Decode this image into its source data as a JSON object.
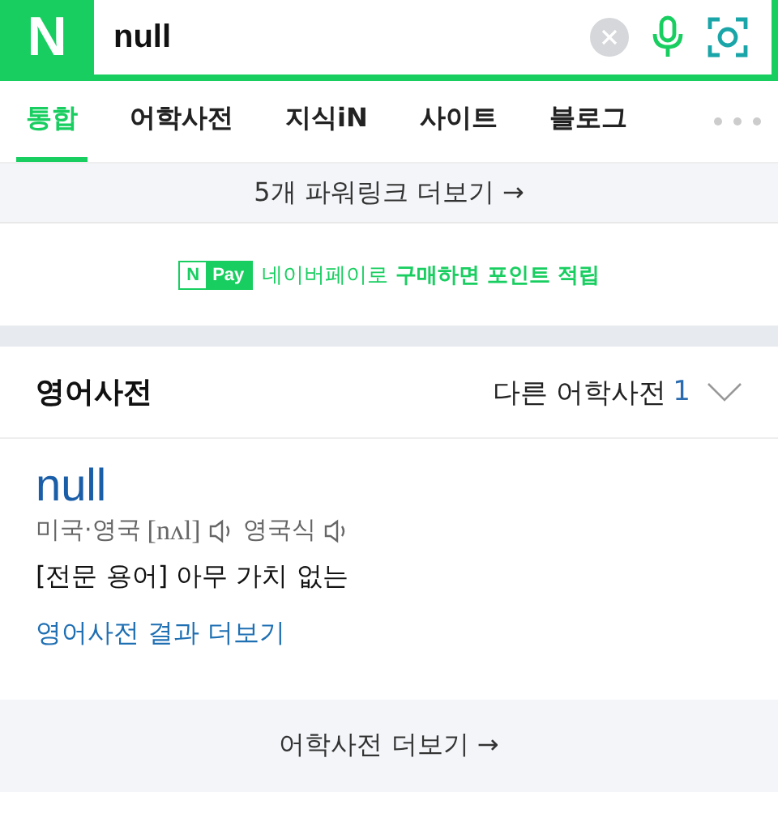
{
  "search": {
    "logo": "N",
    "query": "null"
  },
  "tabs": [
    {
      "label": "통합",
      "selected": true
    },
    {
      "label": "어학사전",
      "selected": false
    },
    {
      "label": "지식iN",
      "selected": false
    },
    {
      "label": "사이트",
      "selected": false
    },
    {
      "label": "블로그",
      "selected": false
    }
  ],
  "powerlink": {
    "label": "5개 파워링크 더보기 →"
  },
  "npay": {
    "badge_n": "N",
    "badge_pay": "Pay",
    "text": "네이버페이로 **구매하면 포인트 적립**"
  },
  "dictionary": {
    "title": "영어사전",
    "other_label": "다른 어학사전",
    "other_count": "1",
    "word": "null",
    "region": "미국·영국",
    "phonetic": "[nʌl]",
    "alt_region": "영국식",
    "meaning": "[전문 용어] 아무 가치 없는",
    "more_link": "영어사전 결과 더보기",
    "footer": "어학사전 더보기 →"
  }
}
